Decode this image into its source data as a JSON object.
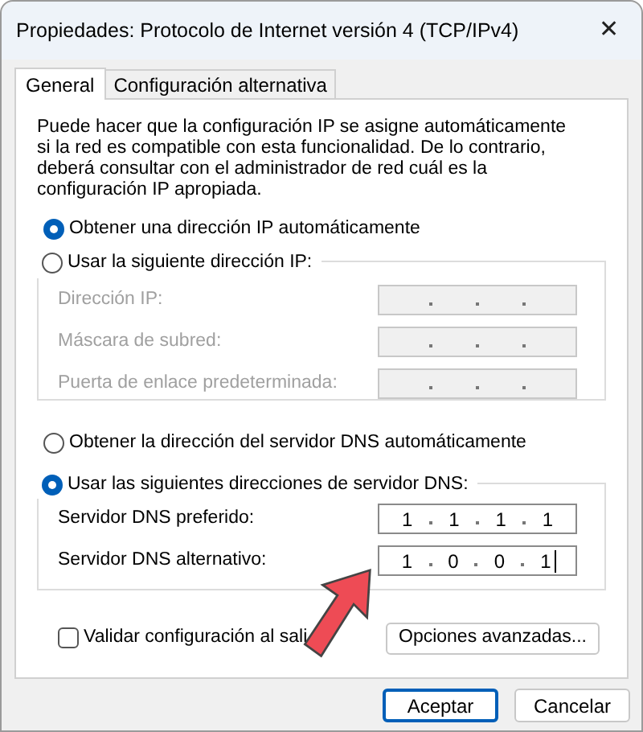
{
  "window": {
    "title": "Propiedades: Protocolo de Internet versión 4 (TCP/IPv4)",
    "close": "✕"
  },
  "tabs": [
    {
      "label": "General",
      "selected": true
    },
    {
      "label": "Configuración alternativa",
      "selected": false
    }
  ],
  "description": "Puede hacer que la configuración IP se asigne automáticamente si la red es compatible con esta funcionalidad. De lo contrario, deberá consultar con el administrador de red cuál es la configuración IP apropiada.",
  "ip_auto": {
    "label": "Obtener una dirección IP automáticamente",
    "selected": true
  },
  "ip_manual": {
    "label": "Usar la siguiente dirección IP:",
    "selected": false,
    "fields": [
      {
        "label": "Dirección IP:",
        "disabled": true
      },
      {
        "label": "Máscara de subred:",
        "disabled": true
      },
      {
        "label": "Puerta de enlace predeterminada:",
        "disabled": true
      }
    ]
  },
  "dns_auto": {
    "label": "Obtener la dirección del servidor DNS automáticamente",
    "selected": false
  },
  "dns_manual": {
    "label": "Usar las siguientes direcciones de servidor DNS:",
    "selected": true,
    "fields": [
      {
        "label": "Servidor DNS preferido:",
        "disabled": false,
        "octets": [
          "1",
          "1",
          "1",
          "1"
        ]
      },
      {
        "label": "Servidor DNS alternativo:",
        "disabled": false,
        "octets": [
          "1",
          "0",
          "0",
          "1"
        ],
        "focused": true
      }
    ]
  },
  "validate": {
    "label": "Validar configuración al sali",
    "checked": false
  },
  "advanced_button": "Opciones avanzadas...",
  "buttons": [
    {
      "label": "Aceptar",
      "default": true
    },
    {
      "label": "Cancelar",
      "default": false
    }
  ]
}
